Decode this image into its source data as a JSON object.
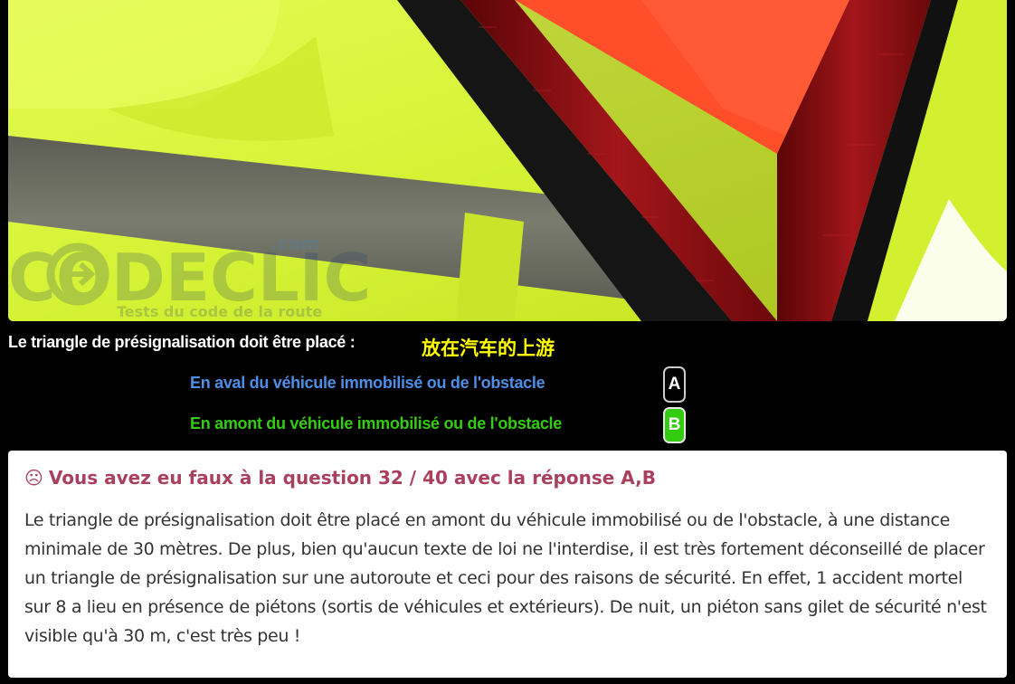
{
  "image": {
    "watermark_brand": "CODECLIC",
    "watermark_domain": ".com",
    "watermark_tagline": "Tests du code de la route",
    "icon": "arrow-right-circle-icon"
  },
  "question": {
    "text": "Le triangle de présignalisation doit être placé :",
    "translation": "放在汽车的上游"
  },
  "answers": [
    {
      "letter": "A",
      "text": "En aval du véhicule immobilisé ou de l'obstacle",
      "color": "#4d8fe6",
      "selected": false
    },
    {
      "letter": "B",
      "text": "En amont du véhicule immobilisé ou de l'obstacle",
      "color": "#33cc11",
      "selected": true
    }
  ],
  "result": {
    "icon": "sad-face-icon",
    "icon_glyph": "☹",
    "title": "Vous avez eu faux à la question 32 / 40 avec la réponse A,B",
    "explanation": "Le triangle de présignalisation doit être placé en amont du véhicule immobilisé ou de l'obstacle, à une distance minimale de 30 mètres. De plus, bien qu'aucun texte de loi ne l'interdise, il est très fortement déconseillé de placer un triangle de présignalisation sur une autoroute et ceci pour des raisons de sécurité. En effet, 1 accident mortel sur 8 a lieu en présence de piétons (sortis de véhicules et extérieurs). De nuit, un piéton sans gilet de sécurité n'est visible qu'à 30 m, c'est très peu !"
  },
  "colors": {
    "background": "#000000",
    "vest": "#d6f532",
    "reflective_band": "#6e7160",
    "triangle_red": "#8a0f12",
    "triangle_orange": "#ff4f2a",
    "answer_a": "#4d8fe6",
    "answer_b": "#33cc11",
    "translation": "#ffff00",
    "result_title": "#a9405e"
  }
}
